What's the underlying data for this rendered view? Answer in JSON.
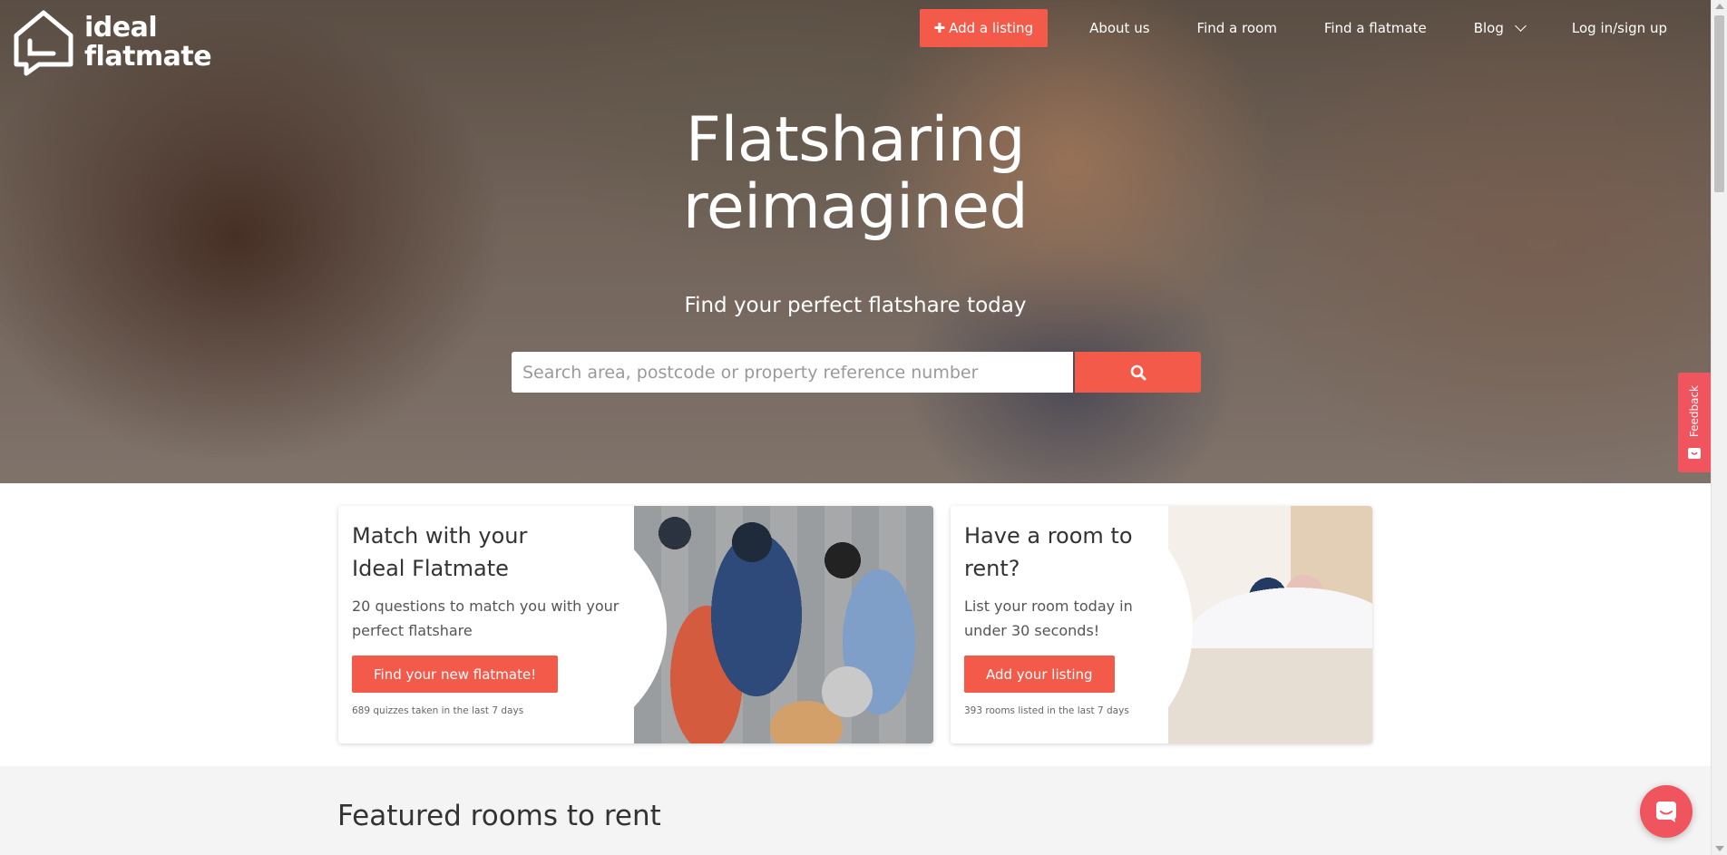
{
  "brand": {
    "line1": "ideal",
    "line2": "flatmate"
  },
  "nav": {
    "add_listing": "Add a listing",
    "about": "About us",
    "find_room": "Find a room",
    "find_flatmate": "Find a flatmate",
    "blog": "Blog",
    "login": "Log in/sign up"
  },
  "hero": {
    "title_line1": "Flatsharing",
    "title_line2": "reimagined",
    "subtitle": "Find your perfect flatshare today",
    "search_placeholder": "Search area, postcode or property reference number"
  },
  "feedback_label": "Feedback",
  "cards": [
    {
      "title_line1": "Match with your",
      "title_line2": "Ideal Flatmate",
      "desc_line1": "20 questions to match you with your",
      "desc_line2": "perfect flatshare",
      "button": "Find your new flatmate!",
      "note": "689 quizzes taken in the last 7 days"
    },
    {
      "title_line1": "Have a room to",
      "title_line2": "rent?",
      "desc_line1": "List your room today in",
      "desc_line2": "under 30 seconds!",
      "button": "Add your listing",
      "note": "393 rooms listed in the last 7 days"
    }
  ],
  "featured_title": "Featured rooms to rent",
  "colors": {
    "accent": "#f45a4a",
    "feedback": "#f0555f"
  },
  "icons": [
    "logo-house-chat-icon",
    "search-icon",
    "chevron-down-icon",
    "feedback-smile-icon",
    "chat-bubble-icon"
  ]
}
